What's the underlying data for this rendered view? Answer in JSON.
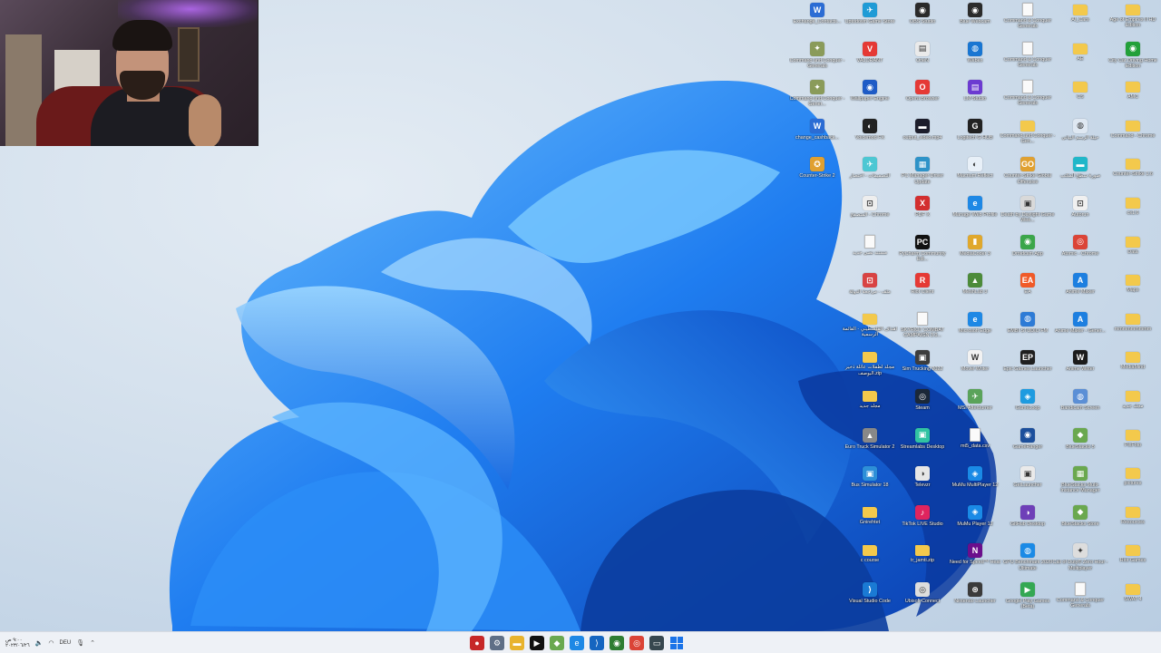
{
  "taskbar": {
    "clock_time": "٩:٠٠ ص",
    "clock_date": "٢٠٢٣/٠٦/٢٦",
    "language": "DEU",
    "apps": [
      {
        "icon": "record-icon",
        "color": "#c62828",
        "glyph": "●"
      },
      {
        "icon": "settings-icon",
        "color": "#5f6f86",
        "glyph": "⚙"
      },
      {
        "icon": "file-explorer-icon",
        "color": "#e8b32d",
        "glyph": "▬"
      },
      {
        "icon": "media-player-icon",
        "color": "#111111",
        "glyph": "▶"
      },
      {
        "icon": "bluestacks-icon",
        "color": "#6aa84f",
        "glyph": "◆"
      },
      {
        "icon": "edge-icon",
        "color": "#1e88e5",
        "glyph": "e"
      },
      {
        "icon": "vscode-icon",
        "color": "#1565c0",
        "glyph": "⟩"
      },
      {
        "icon": "nvidia-icon",
        "color": "#2e7d32",
        "glyph": "◉"
      },
      {
        "icon": "chrome-icon",
        "color": "#db4437",
        "glyph": "◎"
      },
      {
        "icon": "task-view-icon",
        "color": "#37474f",
        "glyph": "▭"
      }
    ]
  },
  "desktop_icons": [
    {
      "label": "Exchange_Contacts...",
      "kind": "app",
      "color": "#2b6cd4",
      "glyph": "W",
      "col": 0,
      "row": 0
    },
    {
      "label": "Command and Conquer - Generals",
      "kind": "app",
      "color": "#8a9b5a",
      "glyph": "✦",
      "col": 0,
      "row": 1
    },
    {
      "label": "Command and Conquer - Gener...",
      "kind": "app",
      "color": "#8a9b5a",
      "glyph": "✦",
      "col": 0,
      "row": 2
    },
    {
      "label": "change_cashback...",
      "kind": "app",
      "color": "#2b6cd4",
      "glyph": "W",
      "col": 0,
      "row": 3
    },
    {
      "label": "Counter-Strike 2",
      "kind": "app",
      "color": "#e0a030",
      "glyph": "✪",
      "col": 0,
      "row": 4
    },
    {
      "label": "Uptodown Game Store",
      "kind": "app",
      "color": "#1f9bd6",
      "glyph": "✈",
      "col": 1,
      "row": 0
    },
    {
      "label": "VALORANT",
      "kind": "app",
      "color": "#e53935",
      "glyph": "V",
      "col": 1,
      "row": 1
    },
    {
      "label": "Wallpaper Engine",
      "kind": "app",
      "color": "#1e5bc6",
      "glyph": "◉",
      "col": 1,
      "row": 2
    },
    {
      "label": "Voicemod FX",
      "kind": "app",
      "color": "#222222",
      "glyph": "◐",
      "col": 1,
      "row": 3
    },
    {
      "label": "التصميمات - اختصار",
      "kind": "app",
      "color": "#4dc7d3",
      "glyph": "✈",
      "col": 1,
      "row": 4
    },
    {
      "label": "المتصفح - Chrome",
      "kind": "app",
      "color": "#eeeeee",
      "glyph": "⊡",
      "col": 1,
      "row": 5
    },
    {
      "label": "مستند نصي جديد",
      "kind": "file",
      "color": "#fafafa",
      "glyph": "",
      "col": 1,
      "row": 6
    },
    {
      "label": "ملف - مراجعة الدولة",
      "kind": "app",
      "color": "#d84343",
      "glyph": "⊡",
      "col": 1,
      "row": 7
    },
    {
      "label": "اهداف الفلسطيني - القائمة الرسمية",
      "kind": "folder",
      "color": "#f3c94c",
      "glyph": "",
      "col": 1,
      "row": 8
    },
    {
      "label": "مجلد لطفلات عائلة ذخير البوصف.zip",
      "kind": "folder",
      "color": "#f3c94c",
      "glyph": "",
      "col": 1,
      "row": 9
    },
    {
      "label": "مجلد جديد",
      "kind": "folder",
      "color": "#f3c94c",
      "glyph": "",
      "col": 1,
      "row": 10
    },
    {
      "label": "Euro Truck Simulator 2",
      "kind": "app",
      "color": "#888888",
      "glyph": "▲",
      "col": 1,
      "row": 11
    },
    {
      "label": "Bus Simulator 18",
      "kind": "app",
      "color": "#2d8fd8",
      "glyph": "▣",
      "col": 1,
      "row": 12
    },
    {
      "label": "Gnirehtet",
      "kind": "folder",
      "color": "#f3c94c",
      "glyph": "",
      "col": 1,
      "row": 13
    },
    {
      "label": "c course",
      "kind": "folder",
      "color": "#f3c94c",
      "glyph": "",
      "col": 1,
      "row": 14
    },
    {
      "label": "Visual Studio Code",
      "kind": "app",
      "color": "#1a7ad4",
      "glyph": "⟩",
      "col": 1,
      "row": 15
    },
    {
      "label": "OBS Studio",
      "kind": "app",
      "color": "#2a2a2a",
      "glyph": "◉",
      "col": 2,
      "row": 0
    },
    {
      "label": "OneN",
      "kind": "app",
      "color": "#eaeaea",
      "glyph": "▤",
      "col": 2,
      "row": 1
    },
    {
      "label": "Opera Browser",
      "kind": "app",
      "color": "#e53935",
      "glyph": "O",
      "col": 2,
      "row": 2
    },
    {
      "label": "output_video.mp4",
      "kind": "app",
      "color": "#1d1d2b",
      "glyph": "▬",
      "col": 2,
      "row": 3
    },
    {
      "label": "PC Manager Driver Update",
      "kind": "app",
      "color": "#2e93c8",
      "glyph": "▦",
      "col": 2,
      "row": 4
    },
    {
      "label": "PDF X",
      "kind": "app",
      "color": "#d32f2f",
      "glyph": "X",
      "col": 2,
      "row": 5
    },
    {
      "label": "PyCharm Community Edi...",
      "kind": "app",
      "color": "#111111",
      "glyph": "PC",
      "col": 2,
      "row": 6
    },
    {
      "label": "Riot Client",
      "kind": "app",
      "color": "#e53935",
      "glyph": "R",
      "col": 2,
      "row": 7
    },
    {
      "label": "SKYRIOT COMBAT CAMPAIGN 3.0...",
      "kind": "file",
      "color": "#fafafa",
      "glyph": "",
      "col": 2,
      "row": 8
    },
    {
      "label": "Sim Trucking 2022",
      "kind": "app",
      "color": "#3d3d3d",
      "glyph": "▣",
      "col": 2,
      "row": 9
    },
    {
      "label": "Steam",
      "kind": "app",
      "color": "#1b2838",
      "glyph": "◎",
      "col": 2,
      "row": 10
    },
    {
      "label": "Streamlabs Desktop",
      "kind": "app",
      "color": "#31c3a2",
      "glyph": "▣",
      "col": 2,
      "row": 11
    },
    {
      "label": "Televzr",
      "kind": "app",
      "color": "#e6e6e6",
      "glyph": "◑",
      "col": 2,
      "row": 12
    },
    {
      "label": "TikTok LIVE Studio",
      "kind": "app",
      "color": "#e0245e",
      "glyph": "♪",
      "col": 2,
      "row": 13
    },
    {
      "label": "tr_jamti.zip",
      "kind": "folder",
      "color": "#f3c94c",
      "glyph": "",
      "col": 2,
      "row": 14
    },
    {
      "label": "Ubisoft Connect",
      "kind": "app",
      "color": "#dddddd",
      "glyph": "◎",
      "col": 2,
      "row": 15
    },
    {
      "label": "Blue Webcam",
      "kind": "app",
      "color": "#2b2b2b",
      "glyph": "◉",
      "col": 3,
      "row": 0
    },
    {
      "label": "Webex",
      "kind": "app",
      "color": "#1976d2",
      "glyph": "◍",
      "col": 3,
      "row": 1
    },
    {
      "label": "LM Studio",
      "kind": "app",
      "color": "#6c3bd1",
      "glyph": "▤",
      "col": 3,
      "row": 2
    },
    {
      "label": "Logitech G HUB",
      "kind": "app",
      "color": "#222222",
      "glyph": "G",
      "col": 3,
      "row": 3
    },
    {
      "label": "Macrium Reflect",
      "kind": "app",
      "color": "#e8f0f8",
      "glyph": "◐",
      "col": 3,
      "row": 4
    },
    {
      "label": "Manage Web Profile",
      "kind": "app",
      "color": "#1e88e5",
      "glyph": "e",
      "col": 3,
      "row": 5
    },
    {
      "label": "MediaCoder 3",
      "kind": "app",
      "color": "#e0a82c",
      "glyph": "▮",
      "col": 3,
      "row": 6
    },
    {
      "label": "MeshLab 3",
      "kind": "app",
      "color": "#4c8b3a",
      "glyph": "▲",
      "col": 3,
      "row": 7
    },
    {
      "label": "Microsoft Edge",
      "kind": "app",
      "color": "#1e88e5",
      "glyph": "e",
      "col": 3,
      "row": 8
    },
    {
      "label": "Movie Writer",
      "kind": "app",
      "color": "#f2f2f2",
      "glyph": "W",
      "col": 3,
      "row": 9
    },
    {
      "label": "MSI Afterburner",
      "kind": "app",
      "color": "#5aa35a",
      "glyph": "✈",
      "col": 3,
      "row": 10
    },
    {
      "label": "mt5_data.csv",
      "kind": "file",
      "color": "#fafafa",
      "glyph": "",
      "col": 3,
      "row": 11
    },
    {
      "label": "MuMu MultiPlayer 12",
      "kind": "app",
      "color": "#1a8ae6",
      "glyph": "◈",
      "col": 3,
      "row": 12
    },
    {
      "label": "MuMu Player 12",
      "kind": "app",
      "color": "#1a8ae6",
      "glyph": "◈",
      "col": 3,
      "row": 13
    },
    {
      "label": "Need for Speed™ Heat",
      "kind": "app",
      "color": "#6b0e8c",
      "glyph": "N",
      "col": 3,
      "row": 14
    },
    {
      "label": "Nintendo Launcher",
      "kind": "app",
      "color": "#3b3b3b",
      "glyph": "⊛",
      "col": 3,
      "row": 15
    },
    {
      "label": "Command & Conquer Generals",
      "kind": "file",
      "color": "#fafafa",
      "glyph": "",
      "col": 4,
      "row": 0
    },
    {
      "label": "Command & Conquer Generals",
      "kind": "file",
      "color": "#fafafa",
      "glyph": "",
      "col": 4,
      "row": 1
    },
    {
      "label": "Command & Conquer Generals",
      "kind": "file",
      "color": "#fafafa",
      "glyph": "",
      "col": 4,
      "row": 2
    },
    {
      "label": "Command and Conquer - Gen...",
      "kind": "folder",
      "color": "#f3c94c",
      "glyph": "",
      "col": 4,
      "row": 3
    },
    {
      "label": "Counter-Strike Global Offensive",
      "kind": "app",
      "color": "#e0a030",
      "glyph": "GO",
      "col": 4,
      "row": 4
    },
    {
      "label": "Death by Daylight Game Wee...",
      "kind": "app",
      "color": "#d9d9d9",
      "glyph": "▣",
      "col": 4,
      "row": 5
    },
    {
      "label": "Droidcam App",
      "kind": "app",
      "color": "#3ba64a",
      "glyph": "◉",
      "col": 4,
      "row": 6
    },
    {
      "label": "EA",
      "kind": "app",
      "color": "#f05a28",
      "glyph": "EA",
      "col": 4,
      "row": 7
    },
    {
      "label": "EMBI STUDIO FM",
      "kind": "app",
      "color": "#2e7bd6",
      "glyph": "◍",
      "col": 4,
      "row": 8
    },
    {
      "label": "Epic Games Launcher",
      "kind": "app",
      "color": "#1f1f1f",
      "glyph": "EP",
      "col": 4,
      "row": 9
    },
    {
      "label": "GameLoop",
      "kind": "app",
      "color": "#1e9be0",
      "glyph": "◈",
      "col": 4,
      "row": 10
    },
    {
      "label": "GameRanger",
      "kind": "app",
      "color": "#1c4f9c",
      "glyph": "◉",
      "col": 4,
      "row": 11
    },
    {
      "label": "GetLauncher",
      "kind": "app",
      "color": "#eaeaea",
      "glyph": "▣",
      "col": 4,
      "row": 12
    },
    {
      "label": "GitHub Desktop",
      "kind": "app",
      "color": "#6e3fb8",
      "glyph": "◑",
      "col": 4,
      "row": 13
    },
    {
      "label": "GPU Benchmark 2020 Ultimate",
      "kind": "app",
      "color": "#1a8ae6",
      "glyph": "◍",
      "col": 4,
      "row": 14
    },
    {
      "label": "Google Play Games (Beta)",
      "kind": "app",
      "color": "#34a853",
      "glyph": "▶",
      "col": 4,
      "row": 15
    },
    {
      "label": "AI_Cars",
      "kind": "folder",
      "color": "#f3c94c",
      "glyph": "",
      "col": 5,
      "row": 0
    },
    {
      "label": "AE",
      "kind": "folder",
      "color": "#f3c94c",
      "glyph": "",
      "col": 5,
      "row": 1
    },
    {
      "label": "CS",
      "kind": "folder",
      "color": "#f3c94c",
      "glyph": "",
      "col": 5,
      "row": 2
    },
    {
      "label": "حيلة الرسم البياني",
      "kind": "app",
      "color": "#dfe8f2",
      "glyph": "◍",
      "col": 5,
      "row": 3
    },
    {
      "label": "صورة سطح المكتب",
      "kind": "app",
      "color": "#20b7c9",
      "glyph": "▬",
      "col": 5,
      "row": 4
    },
    {
      "label": "Autorun",
      "kind": "app",
      "color": "#f0f0f0",
      "glyph": "⊡",
      "col": 5,
      "row": 5
    },
    {
      "label": "Atomic - Chrome",
      "kind": "app",
      "color": "#db4437",
      "glyph": "◎",
      "col": 5,
      "row": 6
    },
    {
      "label": "Anime Maker",
      "kind": "app",
      "color": "#1d7fe0",
      "glyph": "A",
      "col": 5,
      "row": 7
    },
    {
      "label": "Anime Maker - Gener...",
      "kind": "app",
      "color": "#1d7fe0",
      "glyph": "A",
      "col": 5,
      "row": 8
    },
    {
      "label": "Anime Writer",
      "kind": "app",
      "color": "#1b1b1b",
      "glyph": "W",
      "col": 5,
      "row": 9
    },
    {
      "label": "Bandicam Screen",
      "kind": "app",
      "color": "#5b8fd6",
      "glyph": "◍",
      "col": 5,
      "row": 10
    },
    {
      "label": "BlueStacks 5",
      "kind": "app",
      "color": "#6aa84f",
      "glyph": "◆",
      "col": 5,
      "row": 11
    },
    {
      "label": "BlueStacks Multi-Instance Manager",
      "kind": "app",
      "color": "#6aa84f",
      "glyph": "▦",
      "col": 5,
      "row": 12
    },
    {
      "label": "BlueStacks Store",
      "kind": "app",
      "color": "#6aa84f",
      "glyph": "◆",
      "col": 5,
      "row": 13
    },
    {
      "label": "Call of Duty® Zero Hour - Multiplayer",
      "kind": "app",
      "color": "#dddddd",
      "glyph": "✦",
      "col": 5,
      "row": 14
    },
    {
      "label": "Command & Conquer Generals",
      "kind": "file",
      "color": "#fafafa",
      "glyph": "",
      "col": 5,
      "row": 15
    },
    {
      "label": "Age of Empires II HD Edition",
      "kind": "folder",
      "color": "#f3c94c",
      "glyph": "",
      "col": 6,
      "row": 0
    },
    {
      "label": "City Car Driving Home Edition",
      "kind": "app",
      "color": "#22a03a",
      "glyph": "◉",
      "col": 6,
      "row": 1
    },
    {
      "label": "AMC",
      "kind": "folder",
      "color": "#f3c94c",
      "glyph": "",
      "col": 6,
      "row": 2
    },
    {
      "label": "Command - Chrome",
      "kind": "folder",
      "color": "#f3c94c",
      "glyph": "",
      "col": 6,
      "row": 3
    },
    {
      "label": "Counter-Strike 1.6",
      "kind": "folder",
      "color": "#f3c94c",
      "glyph": "",
      "col": 6,
      "row": 4
    },
    {
      "label": "cs1.6",
      "kind": "folder",
      "color": "#f3c94c",
      "glyph": "",
      "col": 6,
      "row": 5
    },
    {
      "label": "Data",
      "kind": "folder",
      "color": "#f3c94c",
      "glyph": "",
      "col": 6,
      "row": 6
    },
    {
      "label": "Maps",
      "kind": "folder",
      "color": "#f3c94c",
      "glyph": "",
      "col": 6,
      "row": 7
    },
    {
      "label": "mmmmmmmmm",
      "kind": "folder",
      "color": "#f3c94c",
      "glyph": "",
      "col": 6,
      "row": 8
    },
    {
      "label": "MediaMind",
      "kind": "folder",
      "color": "#f3c94c",
      "glyph": "",
      "col": 6,
      "row": 9
    },
    {
      "label": "مجلد جديد",
      "kind": "folder",
      "color": "#f3c94c",
      "glyph": "",
      "col": 6,
      "row": 10
    },
    {
      "label": "PixFoto",
      "kind": "folder",
      "color": "#f3c94c",
      "glyph": "",
      "col": 6,
      "row": 11
    },
    {
      "label": "pictures",
      "kind": "folder",
      "color": "#f3c94c",
      "glyph": "",
      "col": 6,
      "row": 12
    },
    {
      "label": "Resources",
      "kind": "folder",
      "color": "#f3c94c",
      "glyph": "",
      "col": 6,
      "row": 13
    },
    {
      "label": "Riot Games",
      "kind": "folder",
      "color": "#f3c94c",
      "glyph": "",
      "col": 6,
      "row": 14
    },
    {
      "label": "SWAT 4",
      "kind": "folder",
      "color": "#f3c94c",
      "glyph": "",
      "col": 6,
      "row": 15
    }
  ]
}
